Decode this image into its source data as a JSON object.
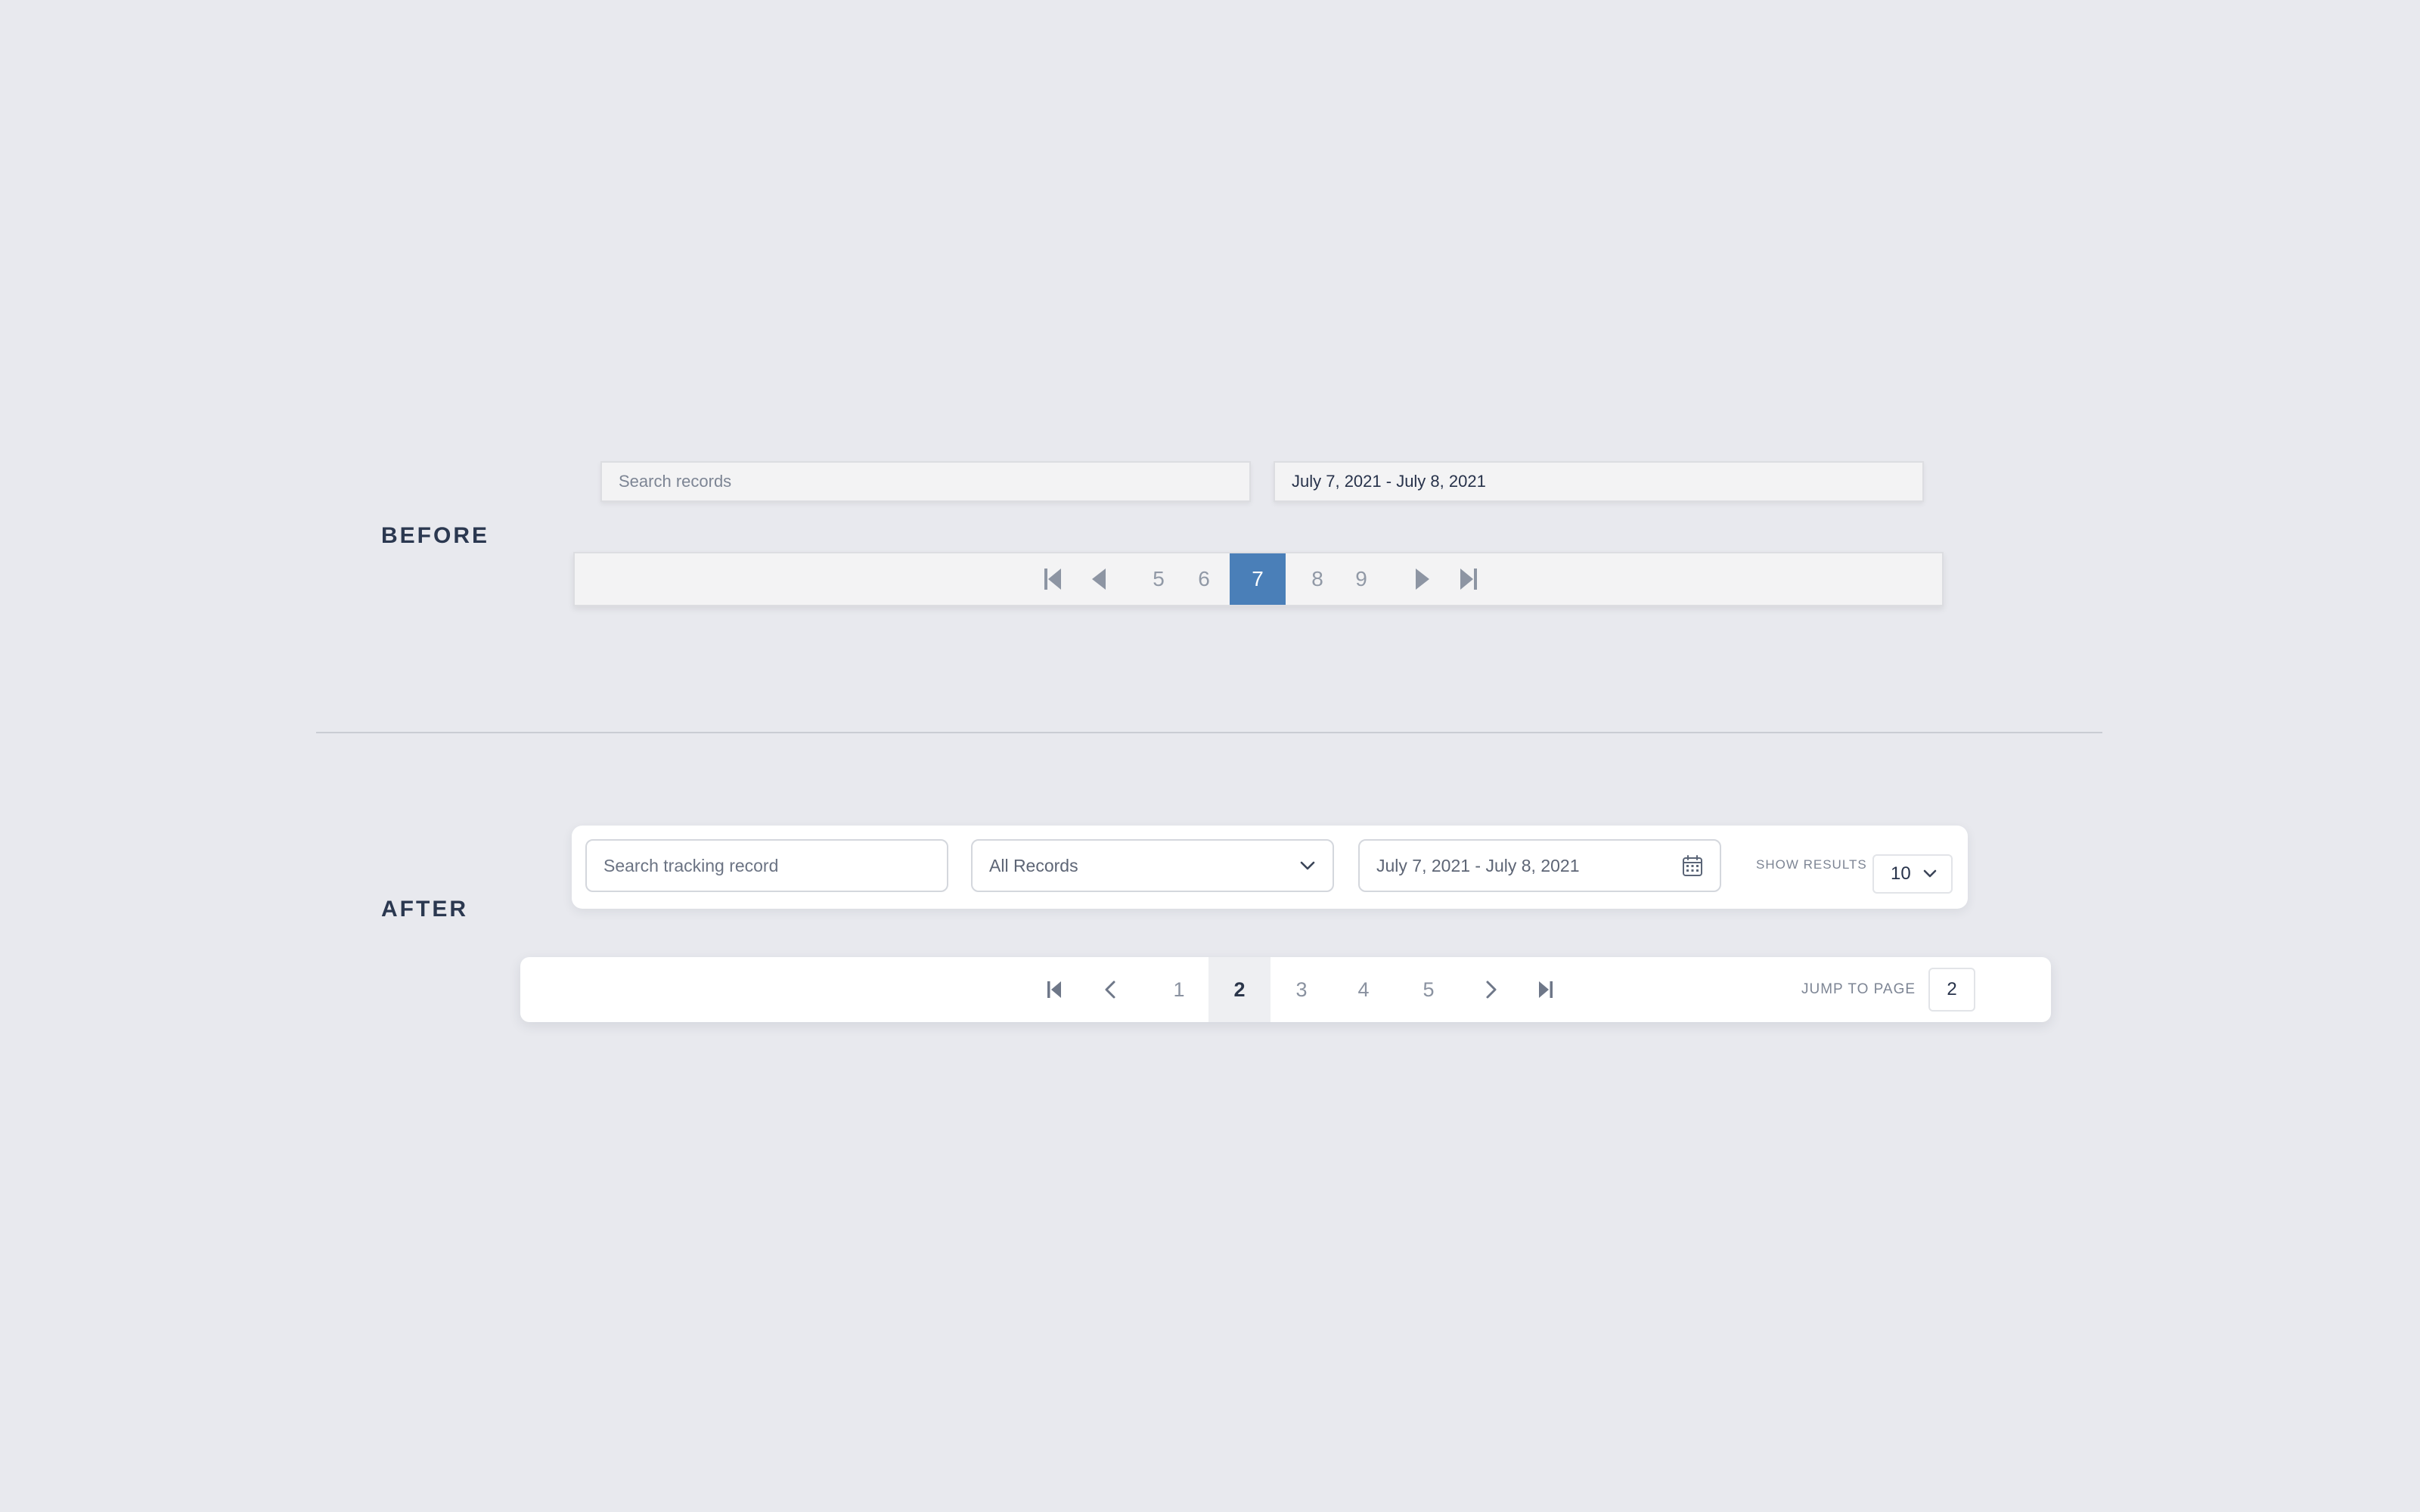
{
  "labels": {
    "before": "BEFORE",
    "after": "AFTER"
  },
  "before": {
    "search_placeholder": "Search records",
    "date_range": "July 7, 2021 - July 8, 2021",
    "pages": [
      "5",
      "6",
      "7",
      "8",
      "9"
    ],
    "active_page": "7",
    "active_color": "#4a7fb8"
  },
  "after": {
    "search_placeholder": "Search tracking record",
    "record_filter": "All Records",
    "date_range": "July 7, 2021 - July 8, 2021",
    "show_results_label": "SHOW RESULTS",
    "show_results_value": "10",
    "pages": [
      "1",
      "2",
      "3",
      "4",
      "5"
    ],
    "active_page": "2",
    "jump_label": "JUMP TO PAGE",
    "jump_value": "2"
  },
  "icons": {
    "first": "first-page-icon",
    "prev": "previous-page-icon",
    "next": "next-page-icon",
    "last": "last-page-icon",
    "calendar": "calendar-icon",
    "chevron": "chevron-down-icon"
  }
}
